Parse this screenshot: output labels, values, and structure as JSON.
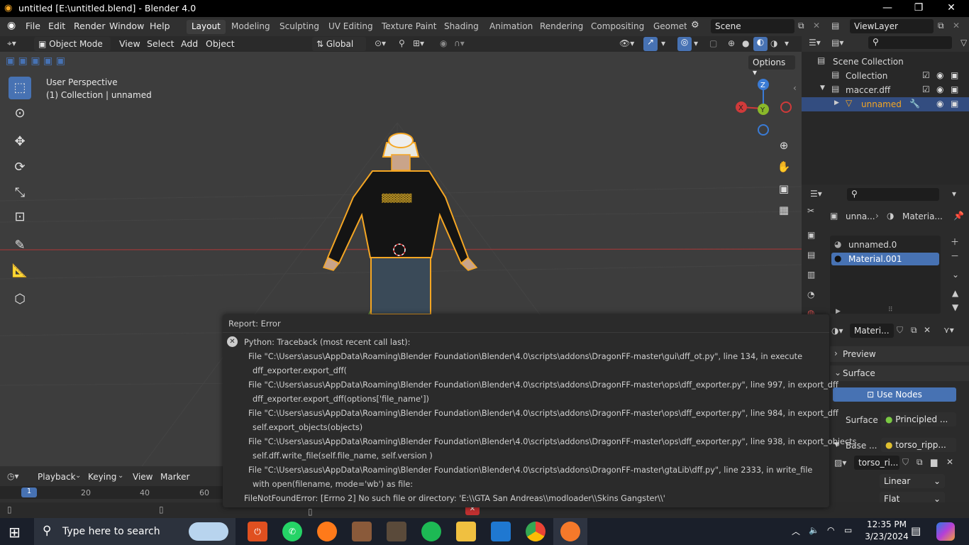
{
  "window": {
    "title": "untitled [E:\\untitled.blend] - Blender 4.0",
    "controls": {
      "minimize": "—",
      "maximize": "❐",
      "close": "✕"
    }
  },
  "menu": {
    "items": [
      "File",
      "Edit",
      "Render",
      "Window",
      "Help"
    ],
    "workspaces": [
      "Layout",
      "Modeling",
      "Sculpting",
      "UV Editing",
      "Texture Paint",
      "Shading",
      "Animation",
      "Rendering",
      "Compositing",
      "Geomet"
    ],
    "scene": "Scene",
    "view_layer": "ViewLayer"
  },
  "viewport_header": {
    "mode": "Object Mode",
    "menus": [
      "View",
      "Select",
      "Add",
      "Object"
    ],
    "transform": "Global",
    "options": "Options"
  },
  "viewport": {
    "perspective": "User Perspective",
    "collection_info": "(1) Collection | unnamed",
    "gizmo": {
      "z": "Z",
      "y": "Y",
      "x": "X"
    }
  },
  "outliner": {
    "root": "Scene Collection",
    "rows": [
      {
        "label": "Collection"
      },
      {
        "label": "maccer.dff"
      },
      {
        "label": "unnamed"
      }
    ]
  },
  "properties": {
    "breadcrumb_obj": "unna...",
    "breadcrumb_mat": "Materia...",
    "slots": [
      "unnamed.0",
      "Material.001"
    ],
    "material_name": "Materi...",
    "preview": "Preview",
    "surface_header": "Surface",
    "use_nodes": "Use Nodes",
    "surface_label": "Surface",
    "surface_value": "Principled ...",
    "base_label": "Base ...",
    "base_value": "torso_ripp...",
    "image_name": "torso_ri...",
    "interp": "Linear",
    "proj": "Flat"
  },
  "report": {
    "title": "Report: Error",
    "lines": [
      "Python: Traceback (most recent call last):",
      "File \"C:\\Users\\asus\\AppData\\Roaming\\Blender Foundation\\Blender\\4.0\\scripts\\addons\\DragonFF-master\\gui\\dff_ot.py\", line 134, in execute",
      "dff_exporter.export_dff(",
      "File \"C:\\Users\\asus\\AppData\\Roaming\\Blender Foundation\\Blender\\4.0\\scripts\\addons\\DragonFF-master\\ops\\dff_exporter.py\", line 997, in export_dff",
      "dff_exporter.export_dff(options['file_name'])",
      "File \"C:\\Users\\asus\\AppData\\Roaming\\Blender Foundation\\Blender\\4.0\\scripts\\addons\\DragonFF-master\\ops\\dff_exporter.py\", line 984, in export_dff",
      "self.export_objects(objects)",
      "File \"C:\\Users\\asus\\AppData\\Roaming\\Blender Foundation\\Blender\\4.0\\scripts\\addons\\DragonFF-master\\ops\\dff_exporter.py\", line 938, in export_objects",
      "self.dff.write_file(self.file_name, self.version )",
      "File \"C:\\Users\\asus\\AppData\\Roaming\\Blender Foundation\\Blender\\4.0\\scripts\\addons\\DragonFF-master\\gtaLib\\dff.py\", line 2333, in write_file",
      "with open(filename, mode='wb') as file:",
      "FileNotFoundError: [Errno 2] No such file or directory: 'E:\\\\GTA San Andreas\\\\modloader\\\\Skins Gangster\\\\'"
    ]
  },
  "timeline": {
    "menus": [
      "Playback",
      "Keying",
      "View",
      "Marker"
    ],
    "current_frame": "1",
    "ticks": [
      "20",
      "40",
      "60"
    ]
  },
  "taskbar": {
    "search_placeholder": "Type here to search",
    "time": "12:35 PM",
    "date": "3/23/2024"
  },
  "colors": {
    "accent": "#4772b3",
    "selection_orange": "#f5a623",
    "error_red": "#e05050"
  }
}
